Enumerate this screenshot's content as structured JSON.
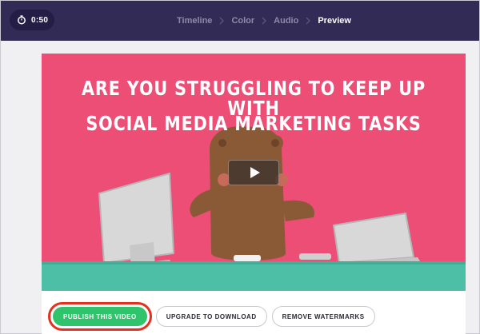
{
  "header": {
    "duration": "0:50",
    "timer_icon": "timer-icon",
    "steps": [
      {
        "label": "Timeline"
      },
      {
        "label": "Color"
      },
      {
        "label": "Audio"
      },
      {
        "label": "Preview"
      }
    ],
    "active_step": "Preview"
  },
  "video": {
    "headline_line1": "ARE YOU STRUGGLING TO KEEP UP WITH",
    "headline_line2": "SOCIAL MEDIA MARKETING TASKS",
    "play_icon": "play-icon"
  },
  "actions": {
    "publish_label": "PUBLISH THIS VIDEO",
    "upgrade_label": "UPGRADE TO DOWNLOAD",
    "watermarks_label": "REMOVE WATERMARKS"
  },
  "colors": {
    "header_bg": "#322b55",
    "video_bg": "#ec4e75",
    "desk": "#4dbfa6",
    "publish": "#2fc46b",
    "highlight": "#e5301e"
  }
}
